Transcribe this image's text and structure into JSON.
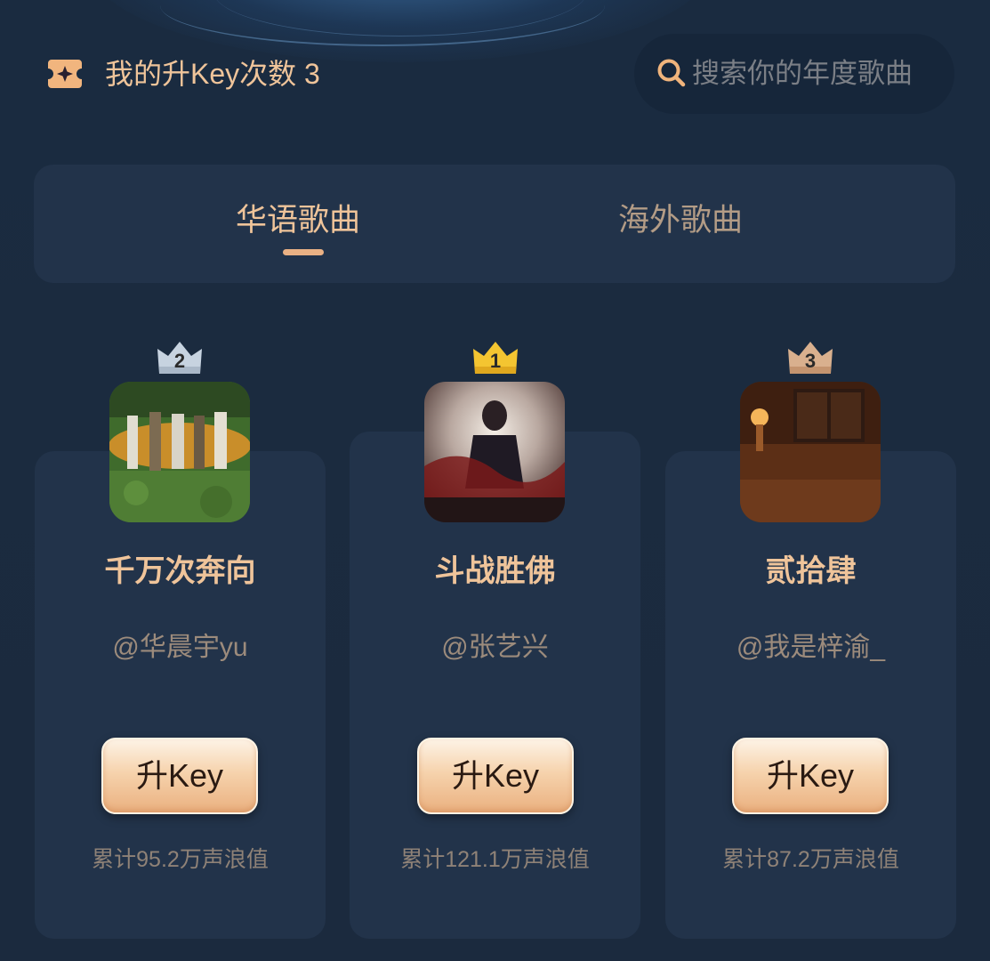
{
  "header": {
    "key_icon": "ticket-sparkle-icon",
    "key_count_text": "我的升Key次数 3",
    "search": {
      "icon": "search-icon",
      "placeholder": "搜索你的年度歌曲"
    }
  },
  "tabs": [
    {
      "label": "华语歌曲",
      "active": true
    },
    {
      "label": "海外歌曲",
      "active": false
    }
  ],
  "songs": [
    {
      "rank": "2",
      "crown_color": "#c7d3e0",
      "title": "千万次奔向",
      "artist": "@华晨宇yu",
      "button_label": "升Key",
      "score": "累计95.2万声浪值"
    },
    {
      "rank": "1",
      "crown_color": "#f2c233",
      "title": "斗战胜佛",
      "artist": "@张艺兴",
      "button_label": "升Key",
      "score": "累计121.1万声浪值"
    },
    {
      "rank": "3",
      "crown_color": "#d9b08e",
      "title": "贰拾肆",
      "artist": "@我是梓渝_",
      "button_label": "升Key",
      "score": "累计87.2万声浪值"
    }
  ],
  "colors": {
    "background": "#1b2a3f",
    "panel": "#22334a",
    "accent_text": "#efc49a",
    "button_gradient_top": "#fdf3e6",
    "button_gradient_bottom": "#eab07f"
  }
}
